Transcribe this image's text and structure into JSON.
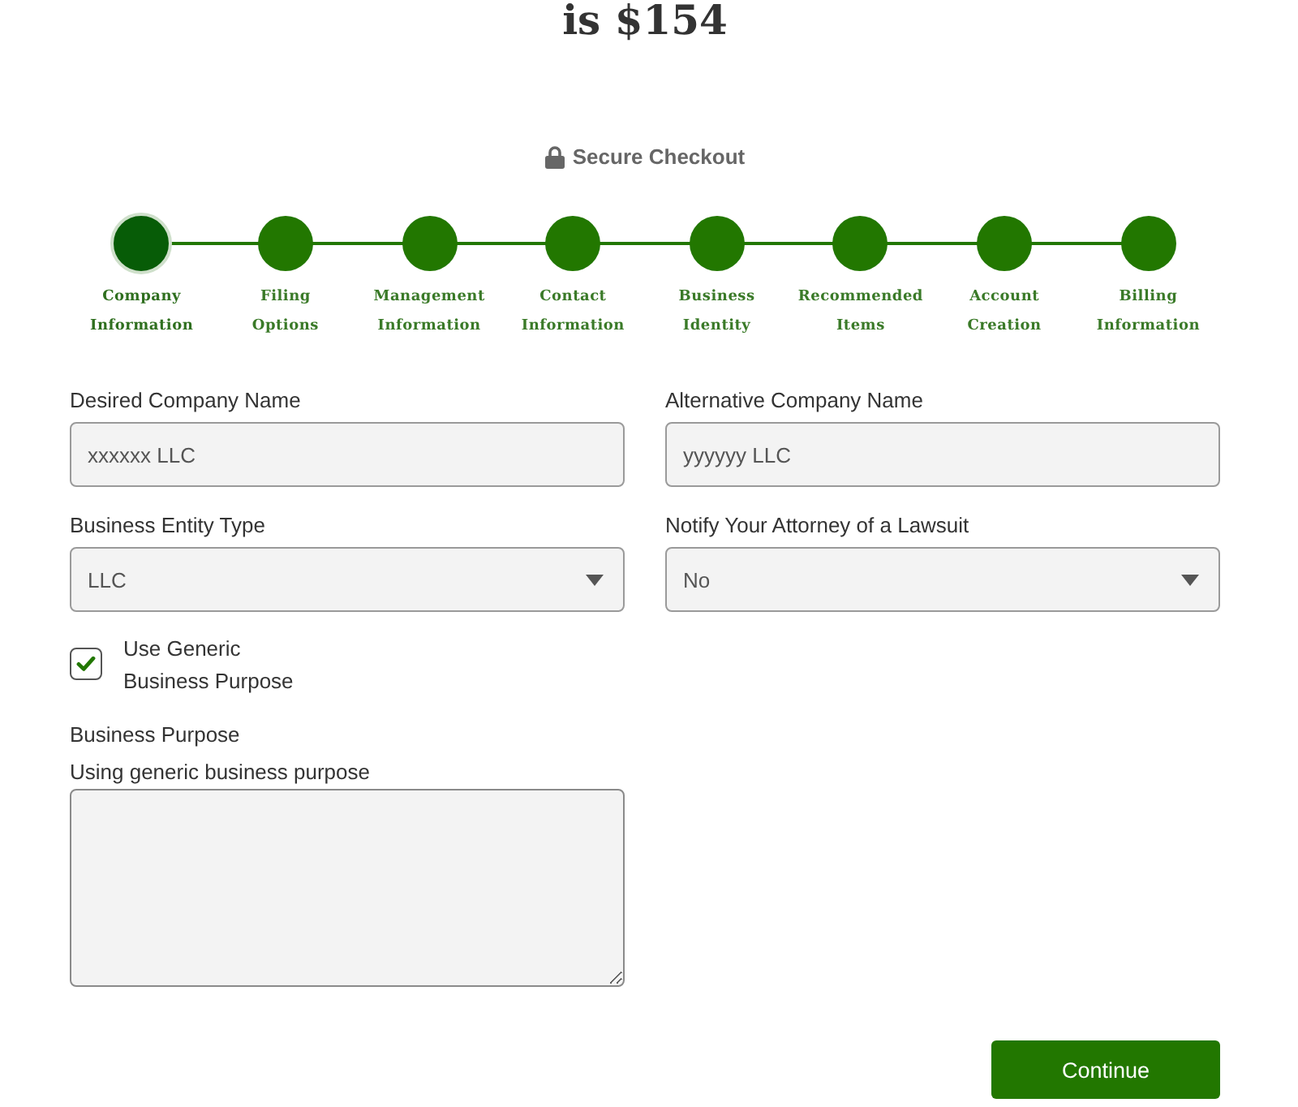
{
  "header": {
    "title": "is $154"
  },
  "secure_badge": {
    "label": "Secure Checkout"
  },
  "steps": [
    {
      "label": "Company Information",
      "selected": true
    },
    {
      "label": "Filing Options",
      "selected": false
    },
    {
      "label": "Management Information",
      "selected": false
    },
    {
      "label": "Contact Information",
      "selected": false
    },
    {
      "label": "Business Identity",
      "selected": false
    },
    {
      "label": "Recommended Items",
      "selected": false
    },
    {
      "label": "Account Creation",
      "selected": false
    },
    {
      "label": "Billing Information",
      "selected": false
    }
  ],
  "form": {
    "fields": [
      {
        "kind": "text",
        "label": "Desired Company Name",
        "value": "xxxxxx LLC"
      },
      {
        "kind": "text",
        "label": "Alternative Company Name",
        "value": "yyyyyy LLC"
      },
      {
        "kind": "select",
        "label": "Business Entity Type",
        "value": "LLC"
      },
      {
        "kind": "select",
        "label": "Notify Your Attorney of a Lawsuit",
        "value": "No"
      }
    ],
    "generic_purpose": {
      "label": "Use Generic Business Purpose",
      "checked": true
    },
    "business_purpose": {
      "label": "Business Purpose",
      "note": "Using generic business purpose"
    }
  },
  "continue_button": {
    "label": "Continue"
  }
}
